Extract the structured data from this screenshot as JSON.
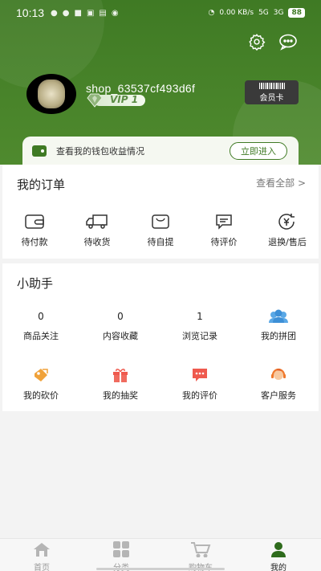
{
  "status_bar": {
    "time": "10:13",
    "icons_left": [
      "message-icon",
      "chat-icon",
      "notification-icon",
      "image-icon",
      "news-icon",
      "signal-icon"
    ],
    "net_speed": "0.00 KB/s",
    "network": "5G",
    "network2": "3G",
    "battery": "88"
  },
  "header": {
    "username": "shop_63537cf493d6f",
    "vip_label": "VIP 1",
    "member_card_label": "会员卡",
    "settings_icon": "gear-icon",
    "message_icon": "chat-bubble-icon"
  },
  "wallet": {
    "text": "查看我的钱包收益情况",
    "button": "立即进入"
  },
  "orders": {
    "title": "我的订单",
    "see_all": "查看全部 >",
    "items": [
      {
        "label": "待付款",
        "icon": "wallet-icon"
      },
      {
        "label": "待收货",
        "icon": "truck-icon"
      },
      {
        "label": "待自提",
        "icon": "bag-icon"
      },
      {
        "label": "待评价",
        "icon": "comment-icon"
      },
      {
        "label": "退换/售后",
        "icon": "refund-icon"
      }
    ]
  },
  "helper": {
    "title": "小助手",
    "stats": [
      {
        "value": "0",
        "label": "商品关注"
      },
      {
        "value": "0",
        "label": "内容收藏"
      },
      {
        "value": "1",
        "label": "浏览记录"
      }
    ],
    "group_label": "我的拼团",
    "row2": [
      {
        "label": "我的砍价",
        "icon": "bargain-icon",
        "color": "#f0a23a"
      },
      {
        "label": "我的抽奖",
        "icon": "gift-icon",
        "color": "#ef5a4e"
      },
      {
        "label": "我的评价",
        "icon": "review-icon",
        "color": "#ef5a4e"
      },
      {
        "label": "客户服务",
        "icon": "customer-service-icon",
        "color": "#f07a2e"
      }
    ]
  },
  "tabbar": {
    "tabs": [
      {
        "label": "首页",
        "icon": "home-icon"
      },
      {
        "label": "分类",
        "icon": "category-icon"
      },
      {
        "label": "购物车",
        "icon": "cart-icon"
      },
      {
        "label": "我的",
        "icon": "user-icon"
      }
    ],
    "active": "我的"
  },
  "colors": {
    "brand": "#3f7a24",
    "text": "#222222",
    "muted": "#9a9a9a"
  }
}
